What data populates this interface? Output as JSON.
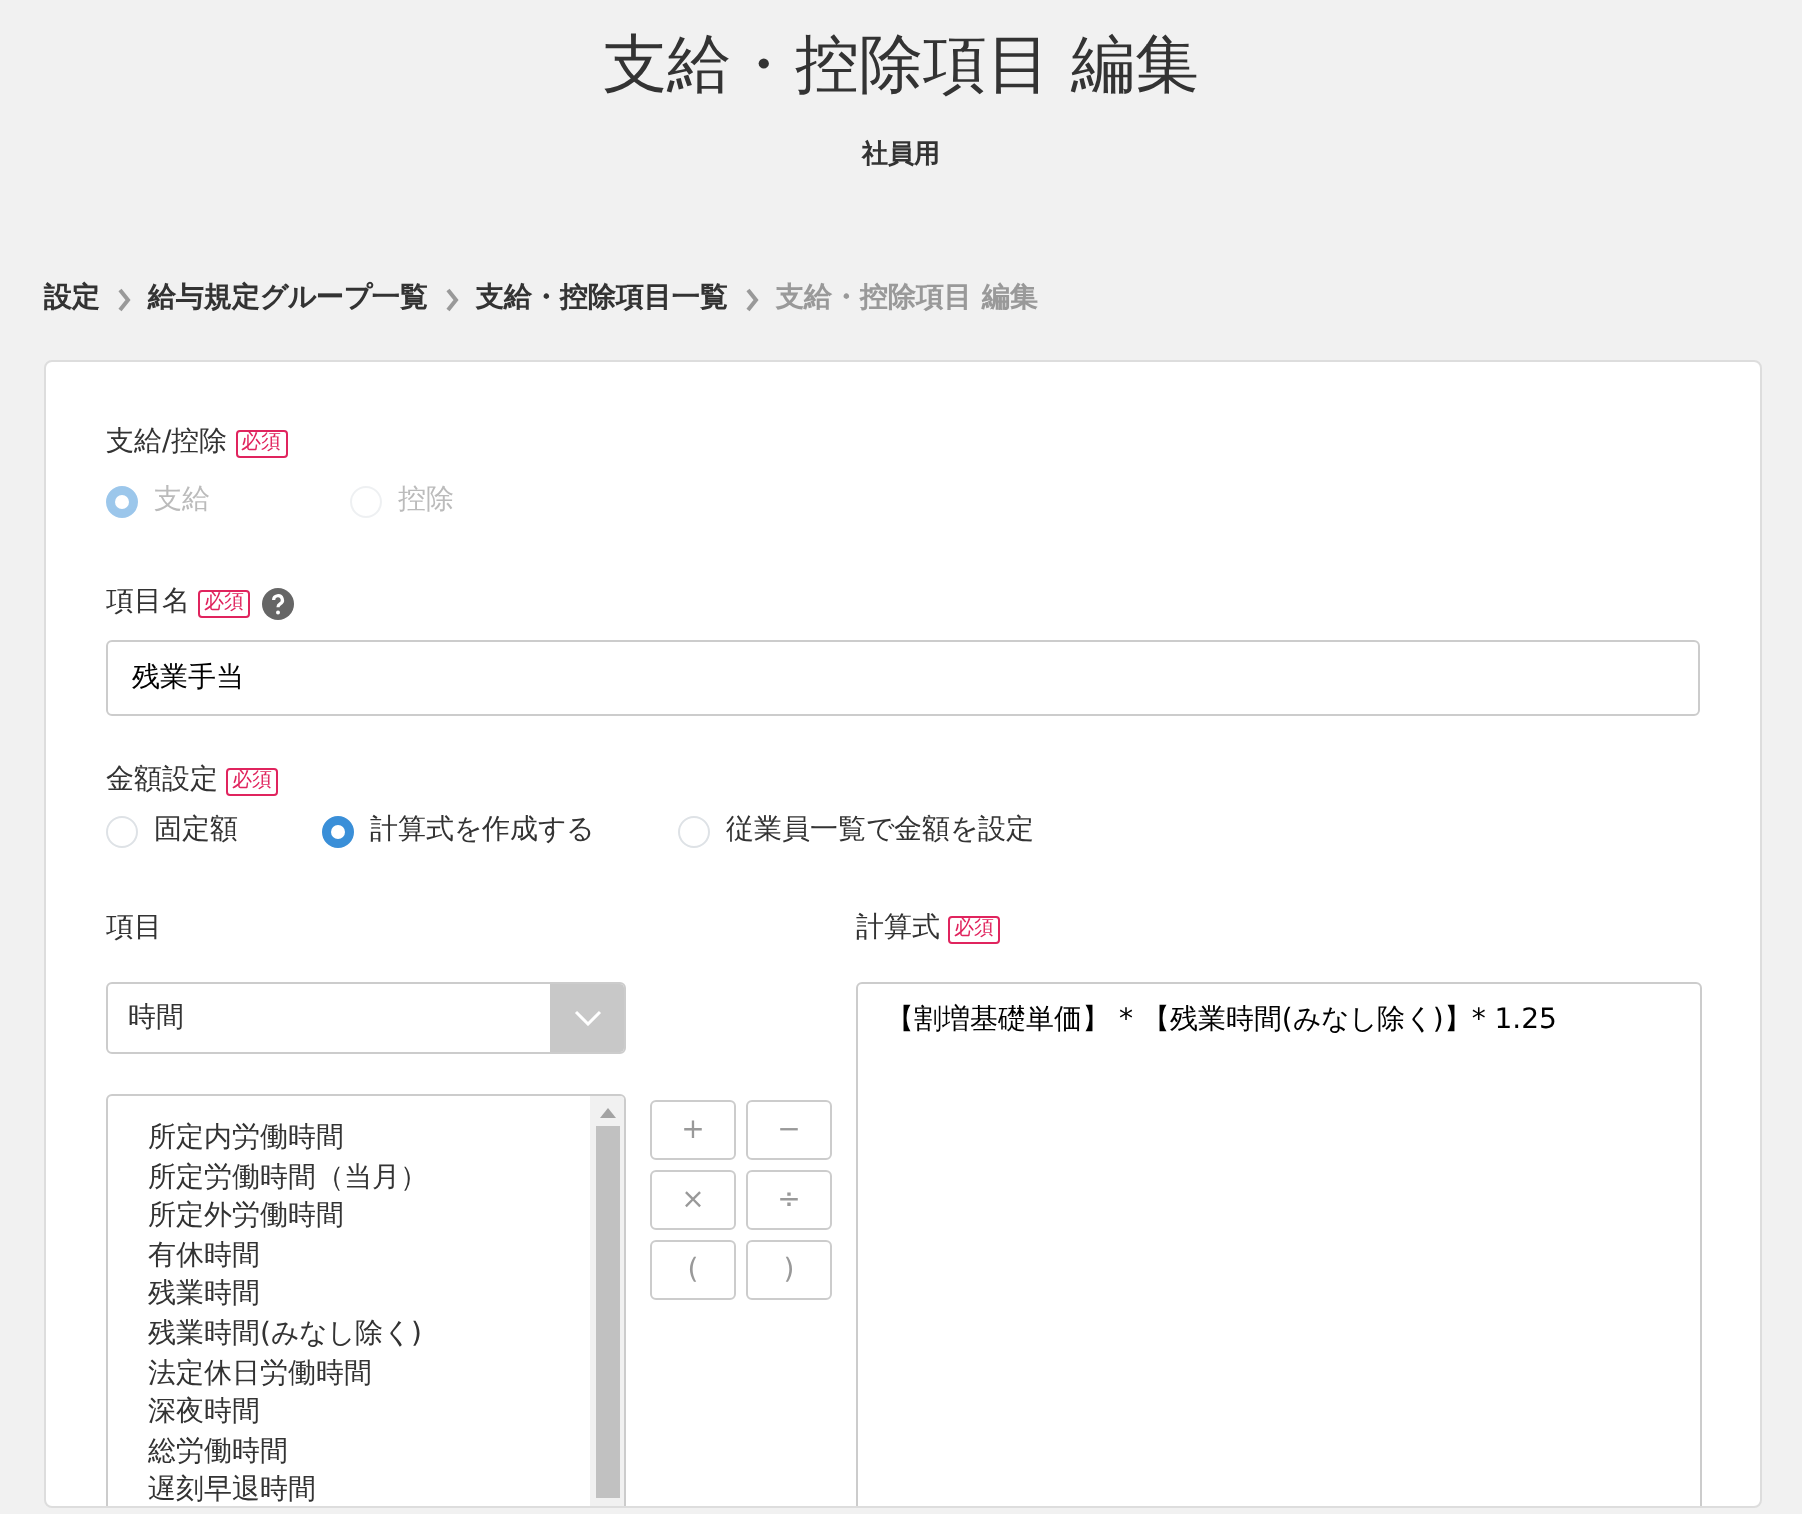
{
  "page": {
    "title": "支給・控除項目 編集",
    "subtitle": "社員用"
  },
  "breadcrumb": [
    {
      "label": "設定",
      "current": false
    },
    {
      "label": "給与規定グループ一覧",
      "current": false
    },
    {
      "label": "支給・控除項目一覧",
      "current": false
    },
    {
      "label": "支給・控除項目 編集",
      "current": true
    }
  ],
  "form": {
    "pay_type": {
      "label": "支給/控除",
      "required_badge": "必須",
      "disabled": true,
      "options": [
        {
          "label": "支給",
          "selected": true
        },
        {
          "label": "控除",
          "selected": false
        }
      ]
    },
    "item_name": {
      "label": "項目名",
      "required_badge": "必須",
      "value": "残業手当"
    },
    "amount_setting": {
      "label": "金額設定",
      "required_badge": "必須",
      "disabled": false,
      "options": [
        {
          "label": "固定額",
          "selected": false
        },
        {
          "label": "計算式を作成する",
          "selected": true
        },
        {
          "label": "従業員一覧で金額を設定",
          "selected": false
        }
      ]
    },
    "items": {
      "label": "項目",
      "select_value": "時間",
      "list": [
        "所定内労働時間",
        "所定労働時間（当月）",
        "所定外労働時間",
        "有休時間",
        "残業時間",
        "残業時間(みなし除く)",
        "法定休日労働時間",
        "深夜時間",
        "総労働時間",
        "遅刻早退時間"
      ]
    },
    "operators": [
      "+",
      "−",
      "×",
      "÷",
      "(",
      ")"
    ],
    "formula": {
      "label": "計算式",
      "required_badge": "必須",
      "value": "【割増基礎単価】 * 【残業時間(みなし除く)】* 1.25"
    }
  }
}
